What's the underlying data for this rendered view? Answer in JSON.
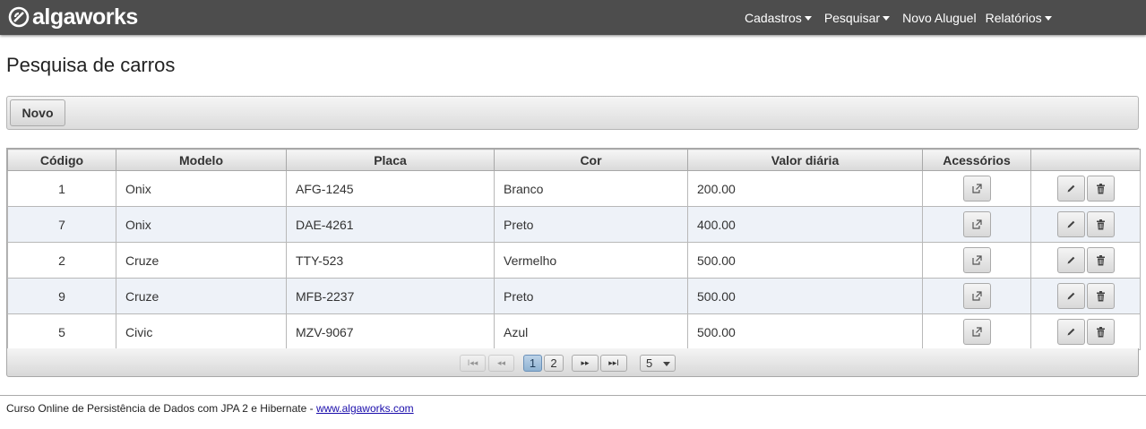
{
  "header": {
    "logo_text": "algaworks",
    "nav": [
      {
        "label": "Cadastros",
        "dropdown": true
      },
      {
        "label": "Pesquisar",
        "dropdown": true
      },
      {
        "label": "Novo Aluguel",
        "dropdown": false
      },
      {
        "label": "Relatórios",
        "dropdown": true
      }
    ]
  },
  "page": {
    "title": "Pesquisa de carros",
    "new_button_label": "Novo"
  },
  "table": {
    "columns": [
      "Código",
      "Modelo",
      "Placa",
      "Cor",
      "Valor diária",
      "Acessórios",
      ""
    ],
    "rows": [
      {
        "codigo": "1",
        "modelo": "Onix",
        "placa": "AFG-1245",
        "cor": "Branco",
        "valor": "200.00"
      },
      {
        "codigo": "7",
        "modelo": "Onix",
        "placa": "DAE-4261",
        "cor": "Preto",
        "valor": "400.00"
      },
      {
        "codigo": "2",
        "modelo": "Cruze",
        "placa": "TTY-523",
        "cor": "Vermelho",
        "valor": "500.00"
      },
      {
        "codigo": "9",
        "modelo": "Cruze",
        "placa": "MFB-2237",
        "cor": "Preto",
        "valor": "500.00"
      },
      {
        "codigo": "5",
        "modelo": "Civic",
        "placa": "MZV-9067",
        "cor": "Azul",
        "valor": "500.00"
      }
    ],
    "row_icons": {
      "accessories": "external-link-icon",
      "edit": "pencil-icon",
      "delete": "trash-icon"
    }
  },
  "paginator": {
    "first_label": "I◂◂",
    "prev_label": "◂◂",
    "pages": [
      "1",
      "2"
    ],
    "current_page": "1",
    "next_label": "▸▸",
    "last_label": "▸▸I",
    "rows_per_page": "5"
  },
  "footer": {
    "text": "Curso Online de Persistência de Dados com JPA 2 e Hibernate - ",
    "link_text": "www.algaworks.com"
  },
  "colors": {
    "topbar": "#4d4d4d",
    "row_alt": "#eef2f8",
    "active_page": "#8fb2d2"
  }
}
